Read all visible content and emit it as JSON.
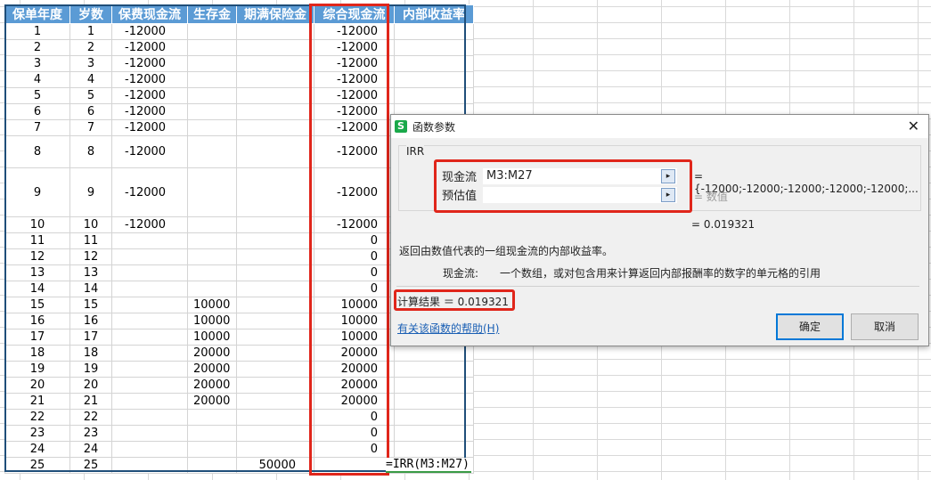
{
  "sheet": {
    "headers": [
      "保单年度",
      "岁数",
      "保费现金流",
      "生存金",
      "期满保险金",
      "综合现金流",
      "内部收益率"
    ],
    "rows": [
      [
        "1",
        "1",
        "-12000",
        "",
        "",
        "-12000",
        ""
      ],
      [
        "2",
        "2",
        "-12000",
        "",
        "",
        "-12000",
        ""
      ],
      [
        "3",
        "3",
        "-12000",
        "",
        "",
        "-12000",
        ""
      ],
      [
        "4",
        "4",
        "-12000",
        "",
        "",
        "-12000",
        ""
      ],
      [
        "5",
        "5",
        "-12000",
        "",
        "",
        "-12000",
        ""
      ],
      [
        "6",
        "6",
        "-12000",
        "",
        "",
        "-12000",
        ""
      ],
      [
        "7",
        "7",
        "-12000",
        "",
        "",
        "-12000",
        ""
      ],
      [
        "8",
        "8",
        "-12000",
        "",
        "",
        "-12000",
        ""
      ],
      [
        "9",
        "9",
        "-12000",
        "",
        "",
        "-12000",
        ""
      ],
      [
        "10",
        "10",
        "-12000",
        "",
        "",
        "-12000",
        ""
      ],
      [
        "11",
        "11",
        "",
        "",
        "",
        "0",
        ""
      ],
      [
        "12",
        "12",
        "",
        "",
        "",
        "0",
        ""
      ],
      [
        "13",
        "13",
        "",
        "",
        "",
        "0",
        ""
      ],
      [
        "14",
        "14",
        "",
        "",
        "",
        "0",
        ""
      ],
      [
        "15",
        "15",
        "",
        "10000",
        "",
        "10000",
        ""
      ],
      [
        "16",
        "16",
        "",
        "10000",
        "",
        "10000",
        ""
      ],
      [
        "17",
        "17",
        "",
        "10000",
        "",
        "10000",
        ""
      ],
      [
        "18",
        "18",
        "",
        "20000",
        "",
        "20000",
        ""
      ],
      [
        "19",
        "19",
        "",
        "20000",
        "",
        "20000",
        ""
      ],
      [
        "20",
        "20",
        "",
        "20000",
        "",
        "20000",
        ""
      ],
      [
        "21",
        "21",
        "",
        "20000",
        "",
        "20000",
        ""
      ],
      [
        "22",
        "22",
        "",
        "",
        "",
        "0",
        ""
      ],
      [
        "23",
        "23",
        "",
        "",
        "",
        "0",
        ""
      ],
      [
        "24",
        "24",
        "",
        "",
        "",
        "0",
        ""
      ],
      [
        "25",
        "25",
        "",
        "",
        "50000",
        "",
        ""
      ]
    ],
    "formula": "=IRR(M3:M27)"
  },
  "dialog": {
    "title": "函数参数",
    "function_name": "IRR",
    "arg1_label": "现金流",
    "arg1_value": "M3:M27",
    "arg1_result": "= {-12000;-12000;-12000;-12000;-12000;...",
    "arg2_label": "预估值",
    "arg2_value": "",
    "arg2_result": "= 数值",
    "result_line": "= 0.019321",
    "description": "返回由数值代表的一组现金流的内部收益率。",
    "arg_help_label": "现金流:",
    "arg_help": "一个数组，或对包含用来计算返回内部报酬率的数字的单元格的引用",
    "calc_result": "计算结果 ＝ 0.019321",
    "help_link": "有关该函数的帮助(H)",
    "ok": "确定",
    "cancel": "取消"
  }
}
